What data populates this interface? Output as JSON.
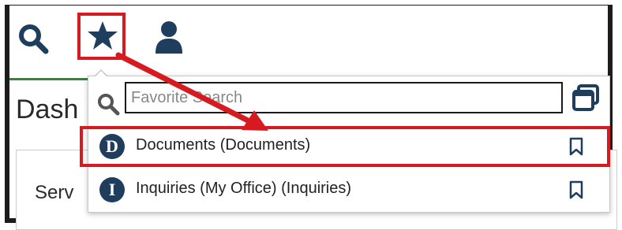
{
  "header": {
    "icons": [
      "search-icon",
      "star-icon",
      "user-icon"
    ]
  },
  "background": {
    "dash_text": "Dash",
    "serv_text": "Serv"
  },
  "dropdown": {
    "search": {
      "placeholder": "Favorite Search",
      "value": ""
    },
    "items": [
      {
        "badge": "D",
        "label": "Documents (Documents)",
        "icon": "bookmark-icon"
      },
      {
        "badge": "I",
        "label": "Inquiries (My Office) (Inquiries)",
        "icon": "bookmark-icon"
      }
    ]
  },
  "colors": {
    "icon_navy": "#1f3d5c",
    "highlight_red": "#d71920",
    "topbar_border_green": "#2e8b2e"
  }
}
